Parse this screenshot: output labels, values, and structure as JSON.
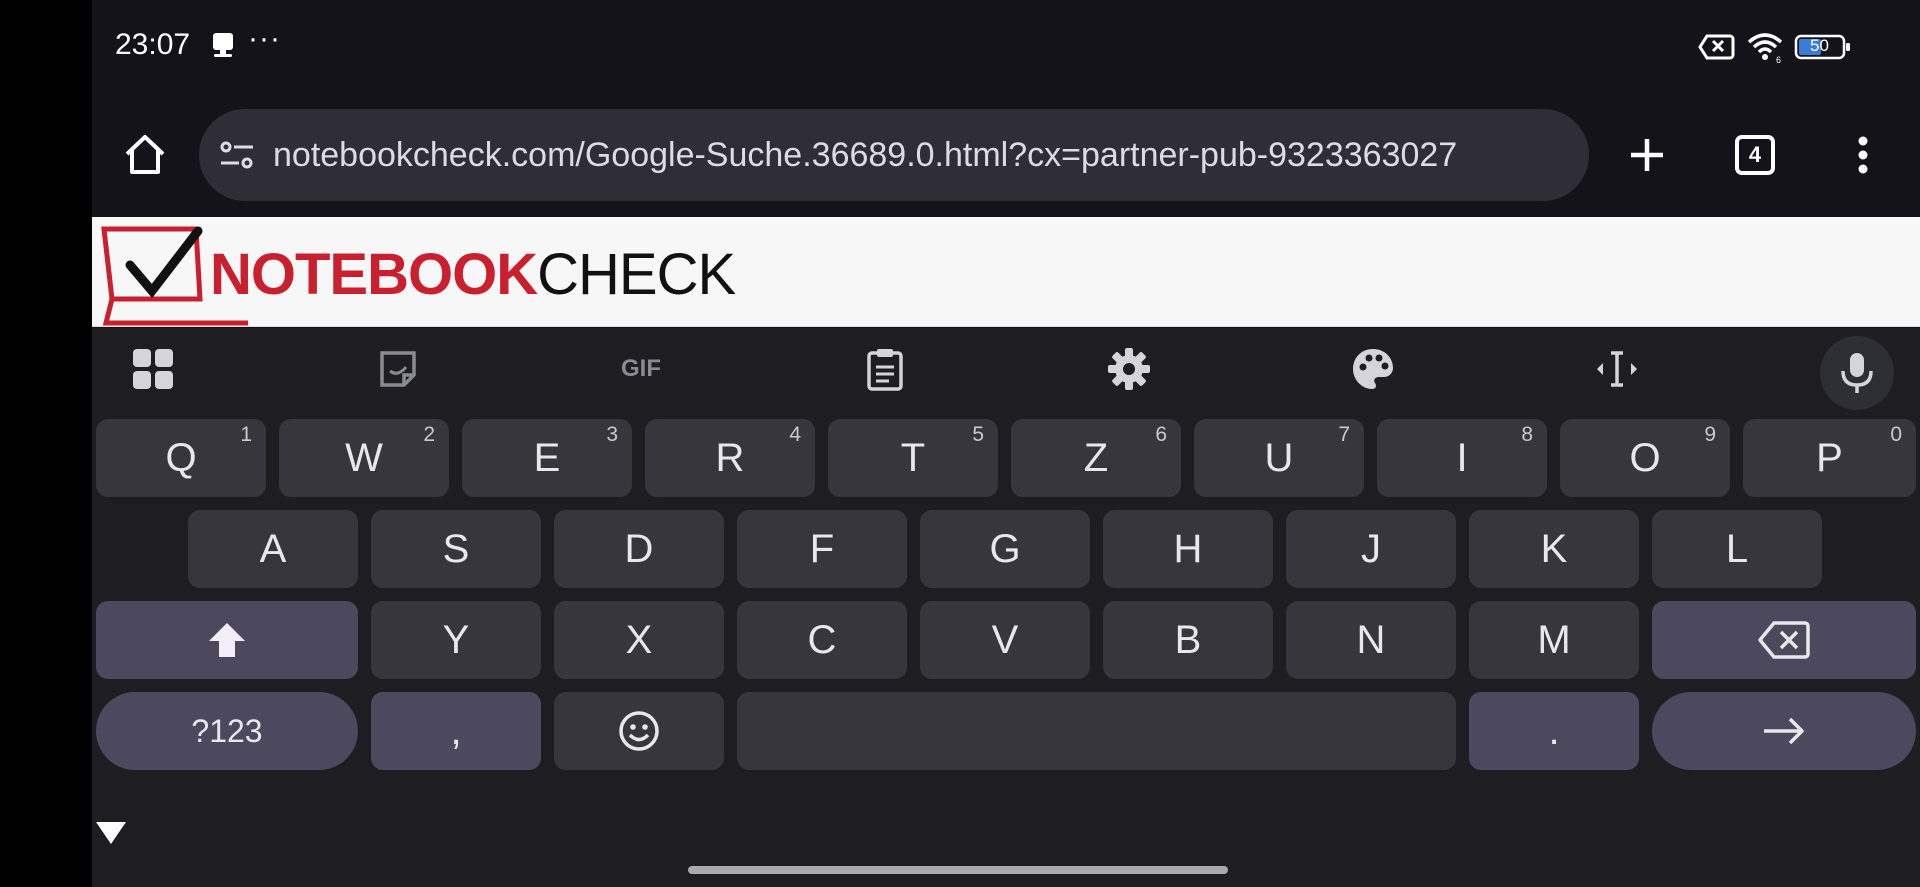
{
  "status_bar": {
    "time": "23:07",
    "more": "···",
    "battery_level": "50",
    "icons": [
      "notification-icon",
      "no-sim-icon",
      "wifi-icon",
      "battery-icon"
    ]
  },
  "toolbar": {
    "url": "notebookcheck.com/Google-Suche.36689.0.html?cx=partner-pub-9323363027",
    "tab_count": "4",
    "icons": [
      "home-icon",
      "site-settings-icon",
      "new-tab-icon",
      "tab-switcher-icon",
      "menu-icon"
    ]
  },
  "web_content": {
    "logo_part1": "NOTEBOOK",
    "logo_part2": "CHECK"
  },
  "keyboard": {
    "toolbar_icons": [
      "apps-grid-icon",
      "sticker-icon",
      "gif-icon",
      "clipboard-icon",
      "settings-icon",
      "palette-icon",
      "text-cursor-icon",
      "mic-icon"
    ],
    "gif_label": "GIF",
    "row1": [
      {
        "label": "Q",
        "hint": "1"
      },
      {
        "label": "W",
        "hint": "2"
      },
      {
        "label": "E",
        "hint": "3"
      },
      {
        "label": "R",
        "hint": "4"
      },
      {
        "label": "T",
        "hint": "5"
      },
      {
        "label": "Z",
        "hint": "6"
      },
      {
        "label": "U",
        "hint": "7"
      },
      {
        "label": "I",
        "hint": "8"
      },
      {
        "label": "O",
        "hint": "9"
      },
      {
        "label": "P",
        "hint": "0"
      }
    ],
    "row2": [
      "A",
      "S",
      "D",
      "F",
      "G",
      "H",
      "J",
      "K",
      "L"
    ],
    "row3": [
      "Y",
      "X",
      "C",
      "V",
      "B",
      "N",
      "M"
    ],
    "symbols_label": "?123",
    "comma_label": ",",
    "period_label": ".",
    "accent_color": "#4c495e"
  }
}
